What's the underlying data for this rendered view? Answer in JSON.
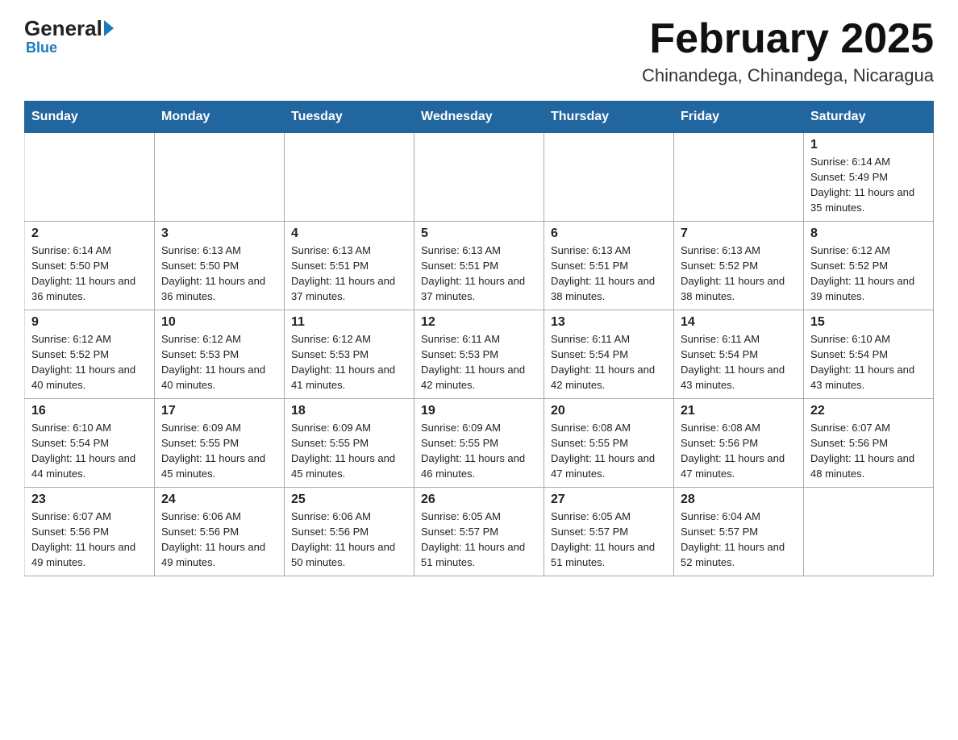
{
  "logo": {
    "general": "General",
    "blue": "Blue",
    "tagline": "Blue"
  },
  "header": {
    "title": "February 2025",
    "subtitle": "Chinandega, Chinandega, Nicaragua"
  },
  "weekdays": [
    "Sunday",
    "Monday",
    "Tuesday",
    "Wednesday",
    "Thursday",
    "Friday",
    "Saturday"
  ],
  "rows": [
    [
      {
        "day": "",
        "info": ""
      },
      {
        "day": "",
        "info": ""
      },
      {
        "day": "",
        "info": ""
      },
      {
        "day": "",
        "info": ""
      },
      {
        "day": "",
        "info": ""
      },
      {
        "day": "",
        "info": ""
      },
      {
        "day": "1",
        "info": "Sunrise: 6:14 AM\nSunset: 5:49 PM\nDaylight: 11 hours and 35 minutes."
      }
    ],
    [
      {
        "day": "2",
        "info": "Sunrise: 6:14 AM\nSunset: 5:50 PM\nDaylight: 11 hours and 36 minutes."
      },
      {
        "day": "3",
        "info": "Sunrise: 6:13 AM\nSunset: 5:50 PM\nDaylight: 11 hours and 36 minutes."
      },
      {
        "day": "4",
        "info": "Sunrise: 6:13 AM\nSunset: 5:51 PM\nDaylight: 11 hours and 37 minutes."
      },
      {
        "day": "5",
        "info": "Sunrise: 6:13 AM\nSunset: 5:51 PM\nDaylight: 11 hours and 37 minutes."
      },
      {
        "day": "6",
        "info": "Sunrise: 6:13 AM\nSunset: 5:51 PM\nDaylight: 11 hours and 38 minutes."
      },
      {
        "day": "7",
        "info": "Sunrise: 6:13 AM\nSunset: 5:52 PM\nDaylight: 11 hours and 38 minutes."
      },
      {
        "day": "8",
        "info": "Sunrise: 6:12 AM\nSunset: 5:52 PM\nDaylight: 11 hours and 39 minutes."
      }
    ],
    [
      {
        "day": "9",
        "info": "Sunrise: 6:12 AM\nSunset: 5:52 PM\nDaylight: 11 hours and 40 minutes."
      },
      {
        "day": "10",
        "info": "Sunrise: 6:12 AM\nSunset: 5:53 PM\nDaylight: 11 hours and 40 minutes."
      },
      {
        "day": "11",
        "info": "Sunrise: 6:12 AM\nSunset: 5:53 PM\nDaylight: 11 hours and 41 minutes."
      },
      {
        "day": "12",
        "info": "Sunrise: 6:11 AM\nSunset: 5:53 PM\nDaylight: 11 hours and 42 minutes."
      },
      {
        "day": "13",
        "info": "Sunrise: 6:11 AM\nSunset: 5:54 PM\nDaylight: 11 hours and 42 minutes."
      },
      {
        "day": "14",
        "info": "Sunrise: 6:11 AM\nSunset: 5:54 PM\nDaylight: 11 hours and 43 minutes."
      },
      {
        "day": "15",
        "info": "Sunrise: 6:10 AM\nSunset: 5:54 PM\nDaylight: 11 hours and 43 minutes."
      }
    ],
    [
      {
        "day": "16",
        "info": "Sunrise: 6:10 AM\nSunset: 5:54 PM\nDaylight: 11 hours and 44 minutes."
      },
      {
        "day": "17",
        "info": "Sunrise: 6:09 AM\nSunset: 5:55 PM\nDaylight: 11 hours and 45 minutes."
      },
      {
        "day": "18",
        "info": "Sunrise: 6:09 AM\nSunset: 5:55 PM\nDaylight: 11 hours and 45 minutes."
      },
      {
        "day": "19",
        "info": "Sunrise: 6:09 AM\nSunset: 5:55 PM\nDaylight: 11 hours and 46 minutes."
      },
      {
        "day": "20",
        "info": "Sunrise: 6:08 AM\nSunset: 5:55 PM\nDaylight: 11 hours and 47 minutes."
      },
      {
        "day": "21",
        "info": "Sunrise: 6:08 AM\nSunset: 5:56 PM\nDaylight: 11 hours and 47 minutes."
      },
      {
        "day": "22",
        "info": "Sunrise: 6:07 AM\nSunset: 5:56 PM\nDaylight: 11 hours and 48 minutes."
      }
    ],
    [
      {
        "day": "23",
        "info": "Sunrise: 6:07 AM\nSunset: 5:56 PM\nDaylight: 11 hours and 49 minutes."
      },
      {
        "day": "24",
        "info": "Sunrise: 6:06 AM\nSunset: 5:56 PM\nDaylight: 11 hours and 49 minutes."
      },
      {
        "day": "25",
        "info": "Sunrise: 6:06 AM\nSunset: 5:56 PM\nDaylight: 11 hours and 50 minutes."
      },
      {
        "day": "26",
        "info": "Sunrise: 6:05 AM\nSunset: 5:57 PM\nDaylight: 11 hours and 51 minutes."
      },
      {
        "day": "27",
        "info": "Sunrise: 6:05 AM\nSunset: 5:57 PM\nDaylight: 11 hours and 51 minutes."
      },
      {
        "day": "28",
        "info": "Sunrise: 6:04 AM\nSunset: 5:57 PM\nDaylight: 11 hours and 52 minutes."
      },
      {
        "day": "",
        "info": ""
      }
    ]
  ]
}
